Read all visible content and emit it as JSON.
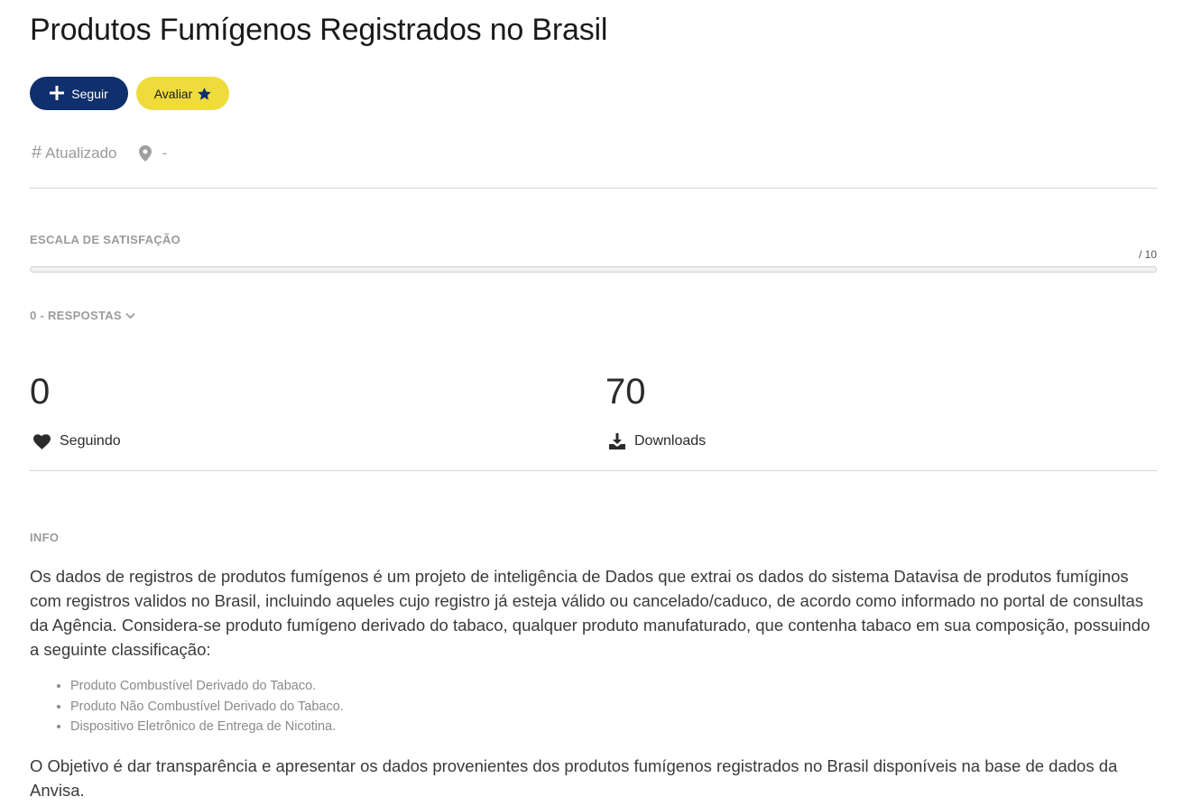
{
  "header": {
    "title": "Produtos Fumígenos Registrados no Brasil"
  },
  "actions": {
    "follow_label": "Seguir",
    "rate_label": "Avaliar"
  },
  "meta": {
    "hash_symbol": "#",
    "status": "Atualizado",
    "location": "-"
  },
  "satisfaction": {
    "label": "ESCALA DE SATISFAÇÃO",
    "max_label": "/ 10",
    "value": 0
  },
  "responses": {
    "label": "0 - RESPOSTAS"
  },
  "stats": {
    "following_count": "0",
    "following_label": "Seguindo",
    "downloads_count": "70",
    "downloads_label": "Downloads"
  },
  "info": {
    "title": "INFO",
    "paragraph1": "Os dados de registros de produtos fumígenos é um projeto de inteligência de Dados que extrai os dados do sistema Datavisa de produtos fumíginos com registros validos no Brasil, incluindo aqueles cujo registro já esteja válido ou cancelado/caduco, de acordo como informado no portal de consultas da Agência. Considera-se produto fumígeno derivado do tabaco, qualquer produto manufaturado, que contenha tabaco em sua composição, possuindo a seguinte classificação:",
    "items": [
      "Produto Combustível Derivado do Tabaco.",
      "Produto Não Combustível Derivado do Tabaco.",
      "Dispositivo Eletrônico de Entrega de Nicotina."
    ],
    "paragraph2": "O Objetivo é dar transparência e apresentar os dados provenientes dos produtos fumígenos registrados no Brasil disponíveis na base de dados da Anvisa."
  },
  "colors": {
    "primary": "#0f2f6d",
    "accent": "#efdc3c"
  }
}
